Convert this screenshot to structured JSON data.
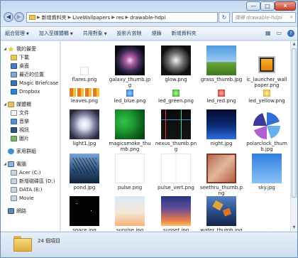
{
  "window": {
    "buttons": {
      "minimize": "—",
      "maximize": "□",
      "close": "✕"
    }
  },
  "address": {
    "crumbs": [
      "新增資料夾",
      "LiveWallpapers",
      "res",
      "drawable-hdpi"
    ],
    "search_placeholder": "搜尋 drawable-hdpi"
  },
  "toolbar": {
    "items": [
      "組合管理",
      "加入至媒體櫃",
      "共用對象",
      "投影片放映",
      "燒錄",
      "新增資料夾"
    ],
    "right_icons": [
      "view-icon",
      "preview-pane-icon",
      "help-icon"
    ]
  },
  "sidebar": {
    "favorites": {
      "label": "我的最愛",
      "items": [
        "下載",
        "桌面",
        "最近的位置",
        "Magic Briefcase",
        "Dropbox"
      ]
    },
    "libraries": {
      "label": "媒體櫃",
      "items": [
        "文件",
        "音樂",
        "視訊",
        "圖片"
      ]
    },
    "homegroup": "家用群組",
    "computer": {
      "label": "電腦",
      "items": [
        "Acer (C:)",
        "新增磁碟區 (D:)",
        "DATA (E:)",
        "Movie"
      ]
    },
    "network": "網路"
  },
  "files": [
    {
      "name": "flares.png",
      "kind": "flares"
    },
    {
      "name": "galaxy_thumb.jpg",
      "kind": "galaxy"
    },
    {
      "name": "glow.png",
      "kind": "glow"
    },
    {
      "name": "grass_thumb.jpg",
      "kind": "grass"
    },
    {
      "name": "ic_launcher_wallpaper.png",
      "kind": "launcher"
    },
    {
      "name": "leaves.png",
      "kind": "leaves"
    },
    {
      "name": "led_blue.png",
      "kind": "led_blue"
    },
    {
      "name": "led_green.png",
      "kind": "led_green"
    },
    {
      "name": "led_red.png",
      "kind": "led_red"
    },
    {
      "name": "led_yellow.png",
      "kind": "led_yellow"
    },
    {
      "name": "light1.jpg",
      "kind": "light1"
    },
    {
      "name": "magicsmoke_thumb.png",
      "kind": "smoke"
    },
    {
      "name": "nexus_thumb.png",
      "kind": "nexus"
    },
    {
      "name": "night.jpg",
      "kind": "night"
    },
    {
      "name": "polarclock_thumb.jpg",
      "kind": "polar"
    },
    {
      "name": "pond.jpg",
      "kind": "pond"
    },
    {
      "name": "pulse.png",
      "kind": "pulse"
    },
    {
      "name": "pulse_vert.png",
      "kind": "pulse_vert"
    },
    {
      "name": "seethru_thumb.png",
      "kind": "seethru"
    },
    {
      "name": "sky.jpg",
      "kind": "sky"
    },
    {
      "name": "space.jpg",
      "kind": "space"
    },
    {
      "name": "sunrise.jpg",
      "kind": "sunrise"
    },
    {
      "name": "sunset.jpg",
      "kind": "sunset"
    },
    {
      "name": "water_thumb.jpg",
      "kind": "water"
    }
  ],
  "status": {
    "count": "24 個項目"
  },
  "colors": {
    "accent": "#3a6fb5",
    "window_frame": "#c4d9f0"
  }
}
